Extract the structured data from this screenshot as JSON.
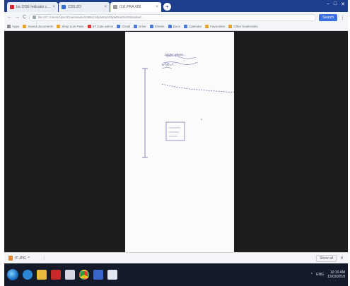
{
  "browser": {
    "tabs": [
      {
        "title": "Inc DOE Indicator ch...",
        "favicon": "red"
      },
      {
        "title": "CDS ZO",
        "favicon": "blue"
      },
      {
        "title": "(1)1.PRA.009",
        "favicon": "gray",
        "active": true
      }
    ],
    "new_tab": "+",
    "window_controls": [
      "–",
      "□",
      "✕"
    ],
    "nav": {
      "back": "←",
      "forward": "→",
      "reload": "C"
    },
    "url": "file:///C:/Users/Upsc/Downloads/ILMBi/1SbpMSa3SbpMSa/d%20dasdeaf...",
    "extension_button": "Search",
    "bookmarks": [
      {
        "label": "Apps",
        "color": "g"
      },
      {
        "label": "Saved documents",
        "color": "o"
      },
      {
        "label": "Shop Live Pass",
        "color": "o"
      },
      {
        "label": "IIT Gate admin",
        "color": "r"
      },
      {
        "label": "Gmail",
        "color": "b"
      },
      {
        "label": "Drive",
        "color": "b"
      },
      {
        "label": "Sheets",
        "color": "b"
      },
      {
        "label": "Docs",
        "color": "b"
      },
      {
        "label": "Calendar",
        "color": "b"
      },
      {
        "label": "Favourites",
        "color": "o"
      },
      {
        "label": "Other bookmarks",
        "color": "o"
      }
    ]
  },
  "document": {
    "handwriting": [
      "tables where...",
      "kr?/D=?..."
    ]
  },
  "download_shelf": {
    "item": "IT-JPG",
    "show_all": "Show all",
    "close": "✕"
  },
  "taskbar": {
    "time": "10:10 AM",
    "date": "13/03/2018",
    "lang": "ENG"
  }
}
